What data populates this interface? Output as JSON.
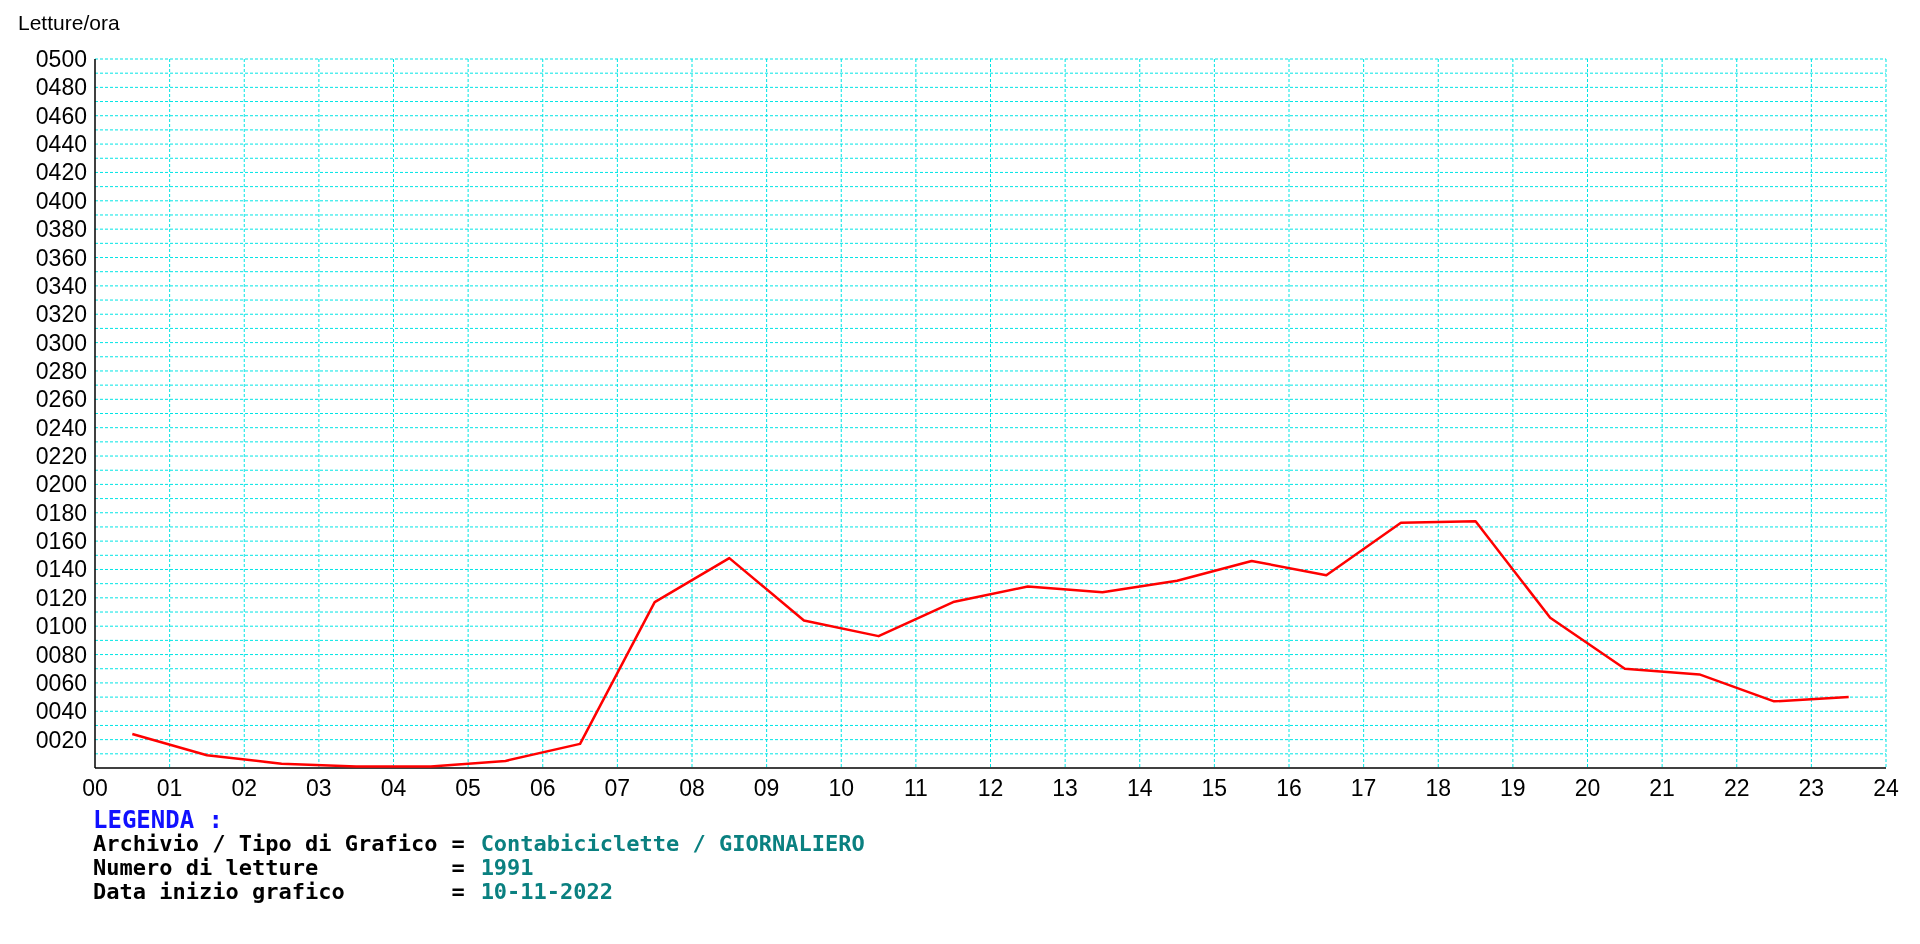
{
  "chart_data": {
    "type": "line",
    "ylabel": "Letture/ora",
    "x": [
      0.5,
      1.5,
      2.5,
      3.5,
      4.5,
      5.5,
      6.5,
      7.5,
      8.5,
      9.5,
      10.5,
      11.5,
      12.5,
      13.5,
      14.5,
      15.5,
      16.5,
      17.5,
      18.5,
      19.5,
      20.5,
      21.5,
      22.5,
      23.5
    ],
    "series": [
      {
        "color": "#ff0000",
        "values": [
          24,
          9,
          3,
          1,
          1,
          5,
          17,
          117,
          148,
          104,
          93,
          117,
          128,
          124,
          132,
          146,
          136,
          173,
          174,
          106,
          70,
          66,
          47,
          50
        ]
      }
    ],
    "xlim": [
      0,
      24
    ],
    "ylim": [
      0,
      500
    ],
    "grid": true,
    "xticks": [
      {
        "value": 0,
        "label": "00"
      },
      {
        "value": 1,
        "label": "01"
      },
      {
        "value": 2,
        "label": "02"
      },
      {
        "value": 3,
        "label": "03"
      },
      {
        "value": 4,
        "label": "04"
      },
      {
        "value": 5,
        "label": "05"
      },
      {
        "value": 6,
        "label": "06"
      },
      {
        "value": 7,
        "label": "07"
      },
      {
        "value": 8,
        "label": "08"
      },
      {
        "value": 9,
        "label": "09"
      },
      {
        "value": 10,
        "label": "10"
      },
      {
        "value": 11,
        "label": "11"
      },
      {
        "value": 12,
        "label": "12"
      },
      {
        "value": 13,
        "label": "13"
      },
      {
        "value": 14,
        "label": "14"
      },
      {
        "value": 15,
        "label": "15"
      },
      {
        "value": 16,
        "label": "16"
      },
      {
        "value": 17,
        "label": "17"
      },
      {
        "value": 18,
        "label": "18"
      },
      {
        "value": 19,
        "label": "19"
      },
      {
        "value": 20,
        "label": "20"
      },
      {
        "value": 21,
        "label": "21"
      },
      {
        "value": 22,
        "label": "22"
      },
      {
        "value": 23,
        "label": "23"
      },
      {
        "value": 24,
        "label": "24"
      }
    ],
    "yticks": [
      {
        "value": 20,
        "label": "0020"
      },
      {
        "value": 40,
        "label": "0040"
      },
      {
        "value": 60,
        "label": "0060"
      },
      {
        "value": 80,
        "label": "0080"
      },
      {
        "value": 100,
        "label": "0100"
      },
      {
        "value": 120,
        "label": "0120"
      },
      {
        "value": 140,
        "label": "0140"
      },
      {
        "value": 160,
        "label": "0160"
      },
      {
        "value": 180,
        "label": "0180"
      },
      {
        "value": 200,
        "label": "0200"
      },
      {
        "value": 220,
        "label": "0220"
      },
      {
        "value": 240,
        "label": "0240"
      },
      {
        "value": 260,
        "label": "0260"
      },
      {
        "value": 280,
        "label": "0280"
      },
      {
        "value": 300,
        "label": "0300"
      },
      {
        "value": 320,
        "label": "0320"
      },
      {
        "value": 340,
        "label": "0340"
      },
      {
        "value": 360,
        "label": "0360"
      },
      {
        "value": 380,
        "label": "0380"
      },
      {
        "value": 400,
        "label": "0400"
      },
      {
        "value": 420,
        "label": "0420"
      },
      {
        "value": 440,
        "label": "0440"
      },
      {
        "value": 460,
        "label": "0460"
      },
      {
        "value": 480,
        "label": "0480"
      },
      {
        "value": 500,
        "label": "0500"
      }
    ]
  },
  "legend": {
    "title": "LEGENDA :",
    "rows": [
      {
        "label": "Archivio / Tipo di Grafico",
        "sep": "=",
        "value": "Contabiciclette / GIORNALIERO"
      },
      {
        "label": "Numero di letture",
        "sep": "=",
        "value": "1991"
      },
      {
        "label": "Data inizio grafico",
        "sep": "=",
        "value": "10-11-2022"
      }
    ]
  }
}
